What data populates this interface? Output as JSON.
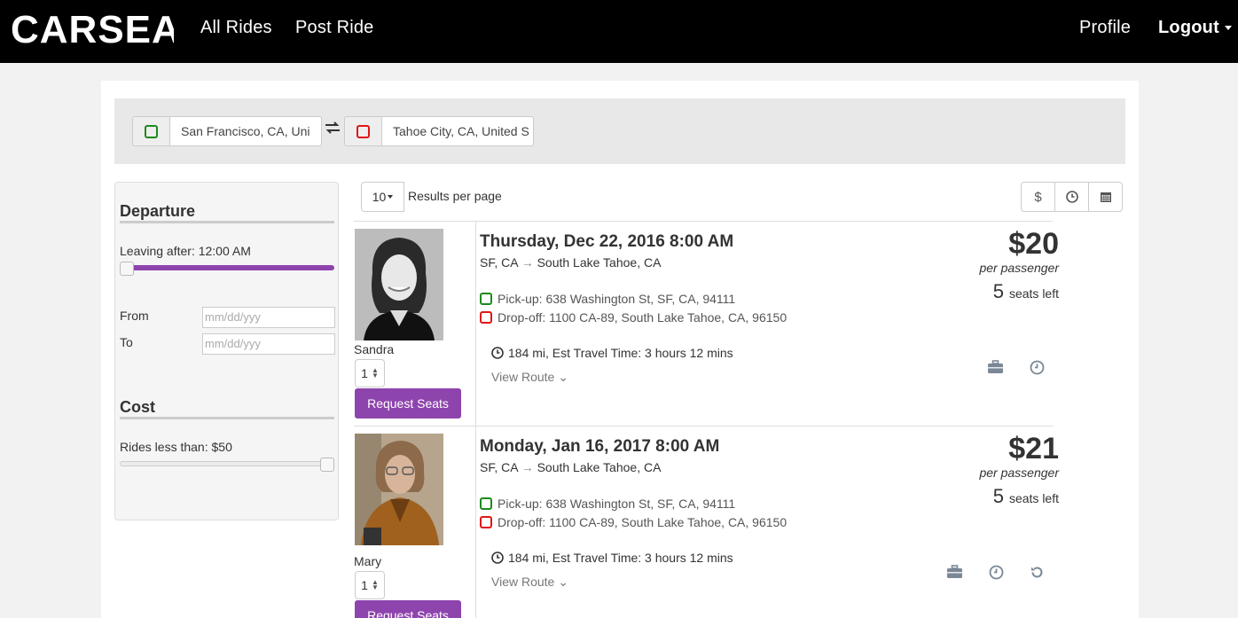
{
  "navbar": {
    "logo_text": "CARSEAT",
    "links": {
      "all_rides": "All Rides",
      "post_ride": "Post Ride",
      "profile": "Profile",
      "logout": "Logout"
    }
  },
  "search": {
    "origin_value": "San Francisco, CA, Uni",
    "destination_value": "Tahoe City, CA, United S",
    "swap_icon": "exchange-icon"
  },
  "filters": {
    "departure_heading": "Departure",
    "leaving_after_label": "Leaving after: 12:00 AM",
    "leaving_after_level": 0,
    "from_label": "From",
    "to_label": "To",
    "date_placeholder": "mm/dd/yyy",
    "cost_heading": "Cost",
    "cost_label": "Rides less than: $50",
    "cost_level": 1,
    "accent_color": "#8e44ad"
  },
  "results_bar": {
    "per_page_value": "10",
    "per_page_label": "Results per page",
    "sort_icons": [
      "dollar-icon",
      "clock-icon",
      "calendar-icon"
    ]
  },
  "rides": [
    {
      "driver": "Sandra",
      "qty": "1",
      "request_label": "Request Seats",
      "date": "Thursday, Dec 22, 2016 8:00 AM",
      "route_from": "SF, CA",
      "route_to": "South Lake Tahoe, CA",
      "pickup": "Pick-up: 638 Washington St, SF, CA, 94111",
      "dropoff": "Drop-off: 1100 CA-89, South Lake Tahoe, CA, 96150",
      "distance": "184 mi, Est Travel Time: 3 hours 12 mins",
      "view_route": "View Route",
      "price": "$20",
      "per_passenger": "per passenger",
      "seats_left_num": "5",
      "seats_left_label": "seats left",
      "icons": [
        "briefcase-icon",
        "clock-icon"
      ]
    },
    {
      "driver": "Mary",
      "qty": "1",
      "request_label": "Request Seats",
      "date": "Monday, Jan 16, 2017 8:00 AM",
      "route_from": "SF, CA",
      "route_to": "South Lake Tahoe, CA",
      "pickup": "Pick-up: 638 Washington St, SF, CA, 94111",
      "dropoff": "Drop-off: 1100 CA-89, South Lake Tahoe, CA, 96150",
      "distance": "184 mi, Est Travel Time: 3 hours 12 mins",
      "view_route": "View Route",
      "price": "$21",
      "per_passenger": "per passenger",
      "seats_left_num": "5",
      "seats_left_label": "seats left",
      "icons": [
        "briefcase-icon",
        "clock-icon",
        "repeat-icon"
      ]
    }
  ]
}
